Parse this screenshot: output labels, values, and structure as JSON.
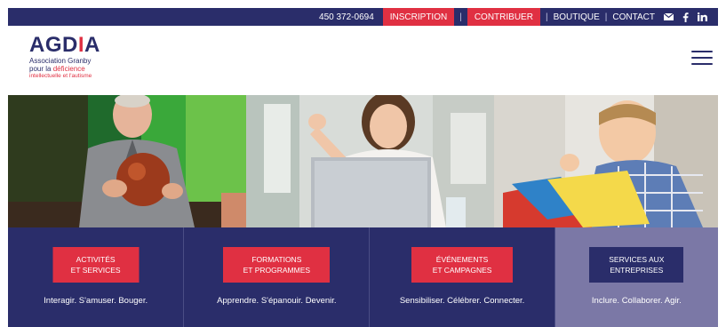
{
  "topbar": {
    "phone": "450 372-0694",
    "inscription": "INSCRIPTION",
    "separator1": "|",
    "contribuer": "CONTRIBUER",
    "separator2": "|",
    "boutique": "BOUTIQUE",
    "separator3": "|",
    "contact": "CONTACT",
    "icons": [
      "mail-icon",
      "facebook-icon",
      "linkedin-icon"
    ]
  },
  "logo": {
    "wordmark_a": "AGD",
    "wordmark_i": "I",
    "wordmark_b": "A",
    "line1": "Association Granby",
    "line2_a": "pour la ",
    "line2_b": "déficience",
    "line3": "intellectuelle et l'autisme"
  },
  "panels": [
    {
      "cta_line1": "ACTIVITÉS",
      "cta_line2": "ET SERVICES",
      "tagline": "Interagir. S'amuser. Bouger."
    },
    {
      "cta_line1": "FORMATIONS",
      "cta_line2": "ET PROGRAMMES",
      "tagline": "Apprendre. S'épanouir. Devenir."
    },
    {
      "cta_line1": "ÉVÉNEMENTS",
      "cta_line2": "ET CAMPAGNES",
      "tagline": "Sensibiliser. Célébrer. Connecter."
    },
    {
      "cta_line1": "SERVICES AUX",
      "cta_line2": "ENTREPRISES",
      "tagline": "Inclure. Collaborer. Agir."
    }
  ],
  "colors": {
    "navy": "#2a2d6a",
    "red": "#e03042",
    "lavender": "#7b78a6"
  }
}
